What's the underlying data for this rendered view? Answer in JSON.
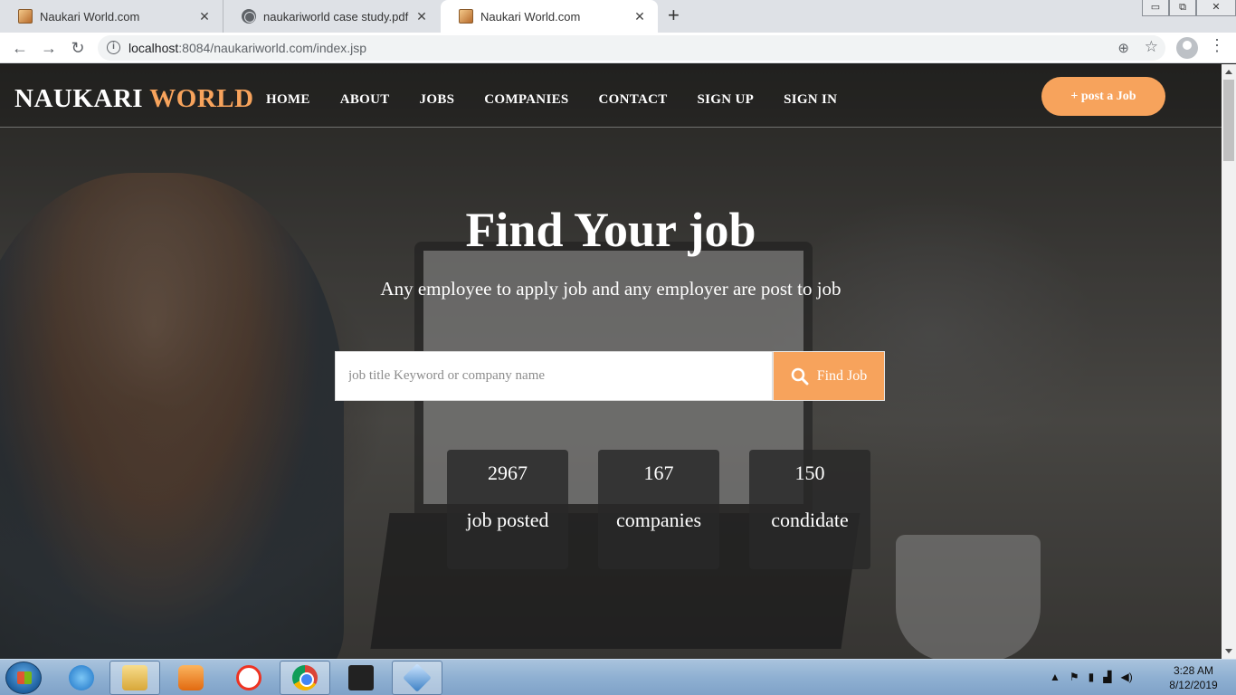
{
  "browser": {
    "tabs": [
      {
        "title": "Naukari World.com",
        "close": "✕"
      },
      {
        "title": "naukariworld case study.pdf",
        "close": "✕"
      },
      {
        "title": "Naukari World.com",
        "close": "✕"
      }
    ],
    "new_tab": "+",
    "address": {
      "host": "localhost",
      "rest": ":8084/naukariworld.com/index.jsp"
    },
    "window_controls": {
      "minimize": "▭",
      "maximize": "⧉",
      "close": "✕"
    }
  },
  "site": {
    "logo": {
      "part1": "NAUKARI",
      "part2": "WORLD"
    },
    "nav": [
      "HOME",
      "ABOUT",
      "JOBS",
      "COMPANIES",
      "CONTACT",
      "SIGN UP",
      "SIGN IN"
    ],
    "post_button": "+ post a Job",
    "hero": {
      "title": "Find Your job",
      "subtitle": "Any employee to apply job and any employer are post to job"
    },
    "search": {
      "placeholder": "job title Keyword or company name",
      "button": "Find Job"
    },
    "stats": [
      {
        "value": "2967",
        "label": "job posted"
      },
      {
        "value": "167",
        "label": "companies"
      },
      {
        "value": "150",
        "label": "condidate"
      }
    ],
    "colors": {
      "accent": "#f7a35c",
      "text": "#ffffff"
    }
  },
  "taskbar": {
    "clock": {
      "time": "3:28 AM",
      "date": "8/12/2019"
    },
    "tray": {
      "arrow": "▲"
    }
  }
}
